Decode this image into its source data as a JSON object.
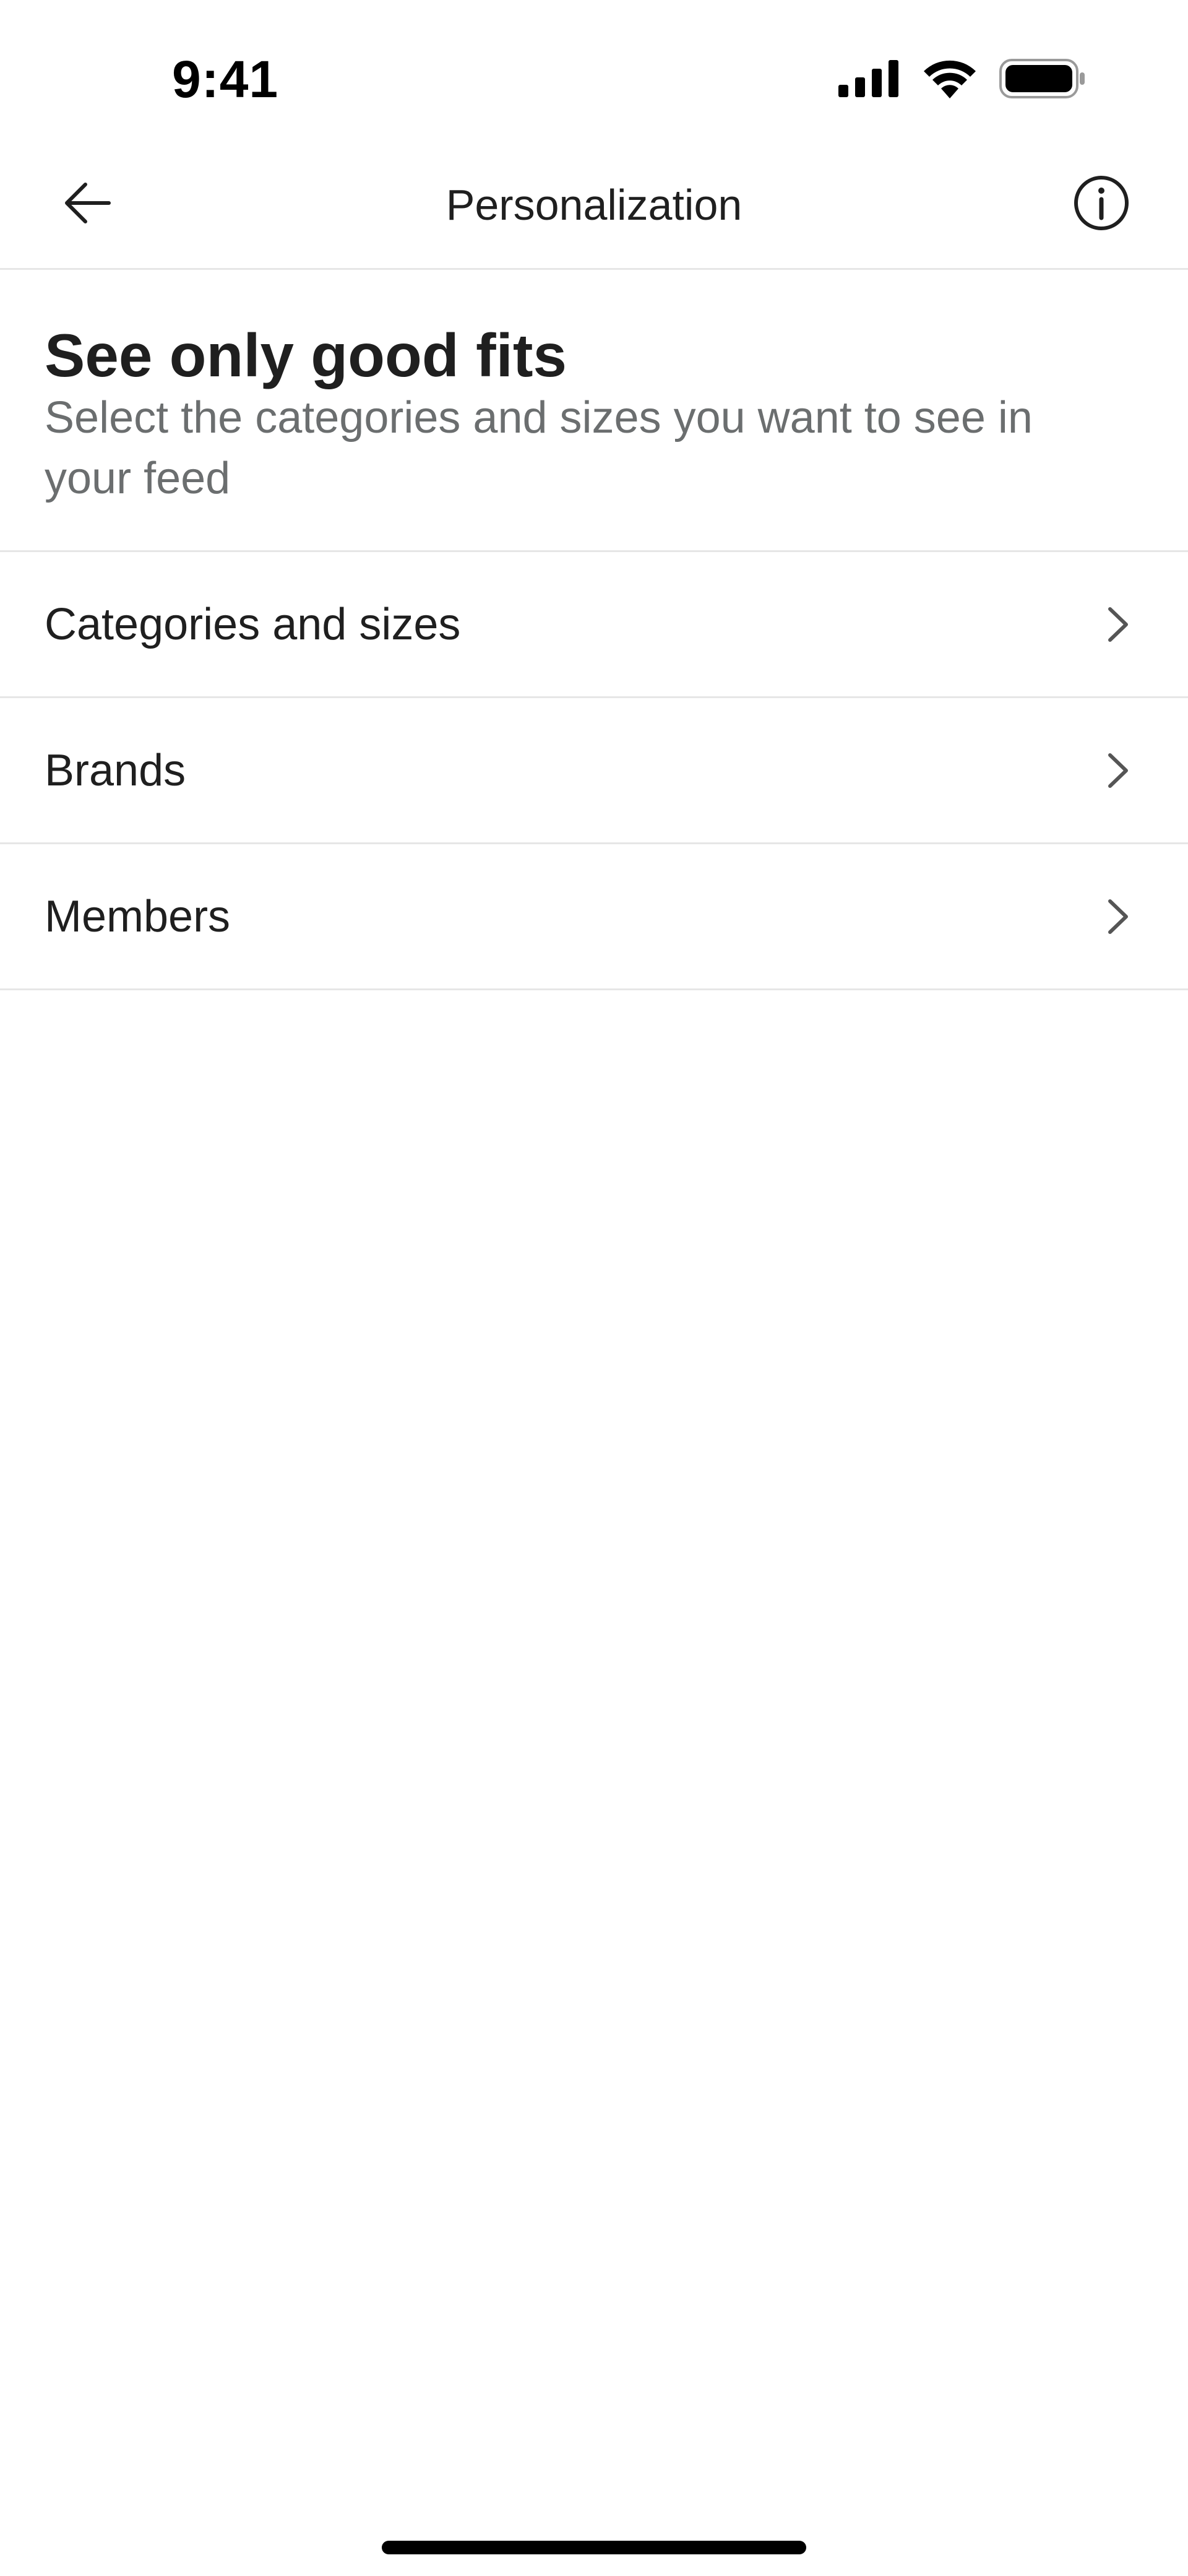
{
  "status_bar": {
    "time": "9:41"
  },
  "nav": {
    "title": "Personalization",
    "back_icon": "arrow-left-icon",
    "info_icon": "info-circle-icon"
  },
  "header": {
    "title": "See only good fits",
    "subtitle": "Select the categories and sizes you want to see in your feed"
  },
  "menu": {
    "items": [
      {
        "label": "Categories and sizes"
      },
      {
        "label": "Brands"
      },
      {
        "label": "Members"
      }
    ]
  },
  "colors": {
    "text_primary": "#1f1f1f",
    "text_secondary": "#6b6e6f",
    "divider": "#e6e6e6",
    "background": "#ffffff"
  }
}
